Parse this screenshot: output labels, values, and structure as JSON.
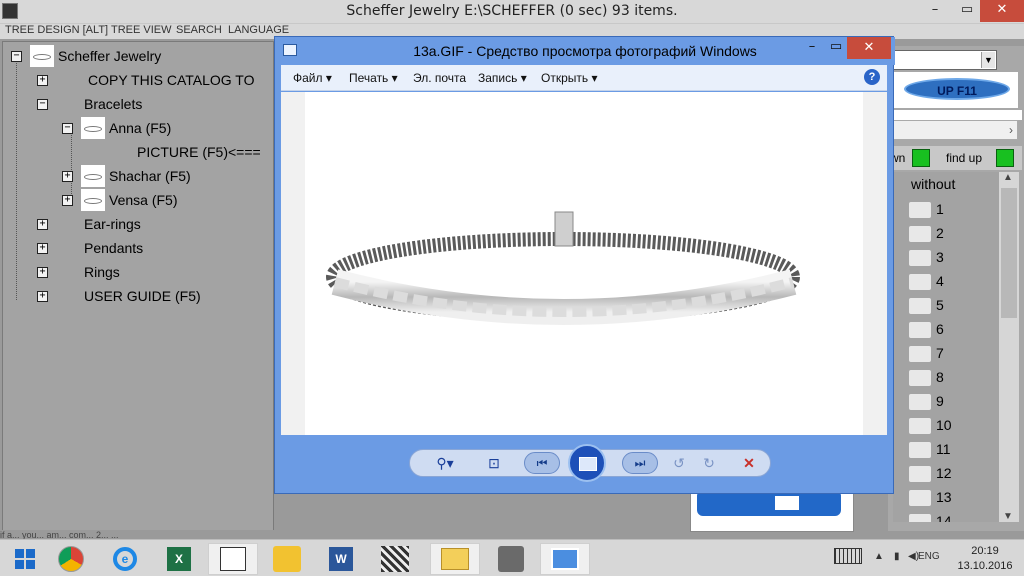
{
  "app": {
    "title": "Scheffer Jewelry E:\\SCHEFFER   (0 sec) 93 items.",
    "minimize": "–",
    "maximize": "▭",
    "close": "✕"
  },
  "menu": {
    "tree_design": "TREE DESIGN [ALT]",
    "tree_view": "TREE VIEW",
    "search": "SEARCH",
    "language": "LANGUAGE"
  },
  "tree": {
    "root": "Scheffer Jewelry",
    "copy": "COPY THIS CATALOG TO",
    "bracelets": "Bracelets",
    "anna": "Anna (F5)",
    "picture": "PICTURE (F5)<===",
    "shachar": "Shachar (F5)",
    "vensa": "Vensa (F5)",
    "earrings": "Ear-rings",
    "pendants": "Pendants",
    "rings": "Rings",
    "guide": "USER GUIDE (F5)"
  },
  "right_panel": {
    "up_label": "UP F11",
    "down_label": "wn",
    "find_up": "find up",
    "list_header": "without",
    "items": [
      "1",
      "2",
      "3",
      "4",
      "5",
      "6",
      "7",
      "8",
      "9",
      "10",
      "11",
      "12",
      "13",
      "14"
    ]
  },
  "viewer": {
    "title": "13a.GIF - Средство просмотра фотографий Windows",
    "menu": {
      "file": "Файл ▾",
      "print": "Печать ▾",
      "email": "Эл. почта",
      "record": "Запись ▾",
      "open": "Открыть ▾",
      "help": "?"
    },
    "toolbar": {
      "zoom": "⚲▾",
      "fit": "⊡",
      "prev": "⏮",
      "next": "⏭",
      "rotate_left": "↺",
      "rotate_right": "↻",
      "delete": "✕"
    }
  },
  "status_text": "if a... you... am... com... 2... ...",
  "taskbar": {
    "lang": "ENG",
    "time": "20:19",
    "date": "13.10.2016"
  },
  "colors": {
    "viewer_blue": "#6b9be4",
    "close_red": "#c74c3c",
    "up_blue": "#2e6fc0",
    "green_button": "#18c020"
  }
}
